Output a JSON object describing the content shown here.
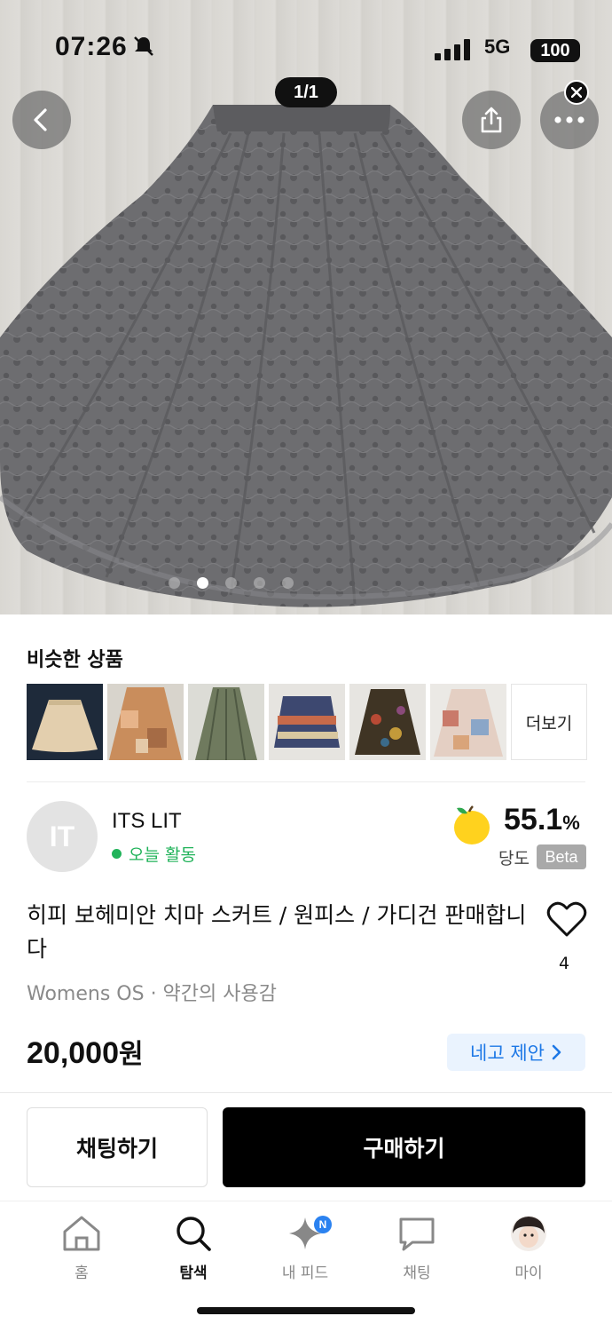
{
  "status_bar": {
    "time": "07:26",
    "network": "5G",
    "battery": "100"
  },
  "image_viewer": {
    "counter": "1/1",
    "total_dots": 5,
    "active_dot": 1
  },
  "similar": {
    "title": "비슷한 상품",
    "more_label": "더보기",
    "thumbnails": [
      "beige-pleated-skirt",
      "orange-patchwork-skirt",
      "olive-pleated-skirt",
      "navy-pattern-skirt",
      "floral-dark-skirt",
      "patchwork-light-skirt"
    ]
  },
  "seller": {
    "initials": "IT",
    "name": "ITS LIT",
    "activity": "오늘 활동",
    "score_value": "55.1",
    "score_unit": "%",
    "score_label": "당도",
    "beta_label": "Beta"
  },
  "product": {
    "title": "히피 보헤미안 치마 스커트 / 원피스 / 가디건 판매합니다",
    "likes": "4",
    "meta": "Womens OS · 약간의 사용감",
    "price_number": "20,000",
    "price_unit": "원",
    "offer_label": "네고 제안"
  },
  "actions": {
    "chat_label": "채팅하기",
    "buy_label": "구매하기"
  },
  "tabbar": {
    "home": "홈",
    "search": "탐색",
    "feed": "내 피드",
    "feed_badge": "N",
    "chat": "채팅",
    "my": "마이"
  },
  "colors": {
    "accent_green": "#21b35a",
    "accent_blue": "#1d78e6",
    "offer_bg": "#eaf3fe",
    "primary_black": "#000000"
  }
}
